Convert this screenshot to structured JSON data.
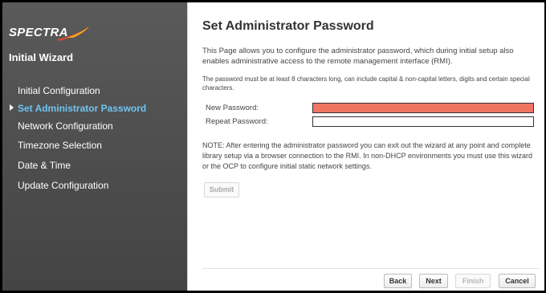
{
  "logo": {
    "text": "SPECTRA",
    "swoosh_color": "#e2482a",
    "swoosh_accent": "#f6a623"
  },
  "sidebar": {
    "title": "Initial Wizard",
    "items": [
      {
        "label": "Initial Configuration",
        "active": false
      },
      {
        "label": "Set Administrator Password",
        "active": true
      },
      {
        "label": "Network Configuration",
        "active": false
      },
      {
        "label": "Timezone Selection",
        "active": false
      },
      {
        "label": "Date & Time",
        "active": false
      },
      {
        "label": "Update Configuration",
        "active": false
      }
    ]
  },
  "main": {
    "title": "Set Administrator Password",
    "description": "This Page allows you to configure the administrator password, which during initial setup also enables administrative access to the remote management interface (RMI).",
    "requirements": "The password must be at least 8 characters long, can include capital & non-capital letters, digits and certain special characters.",
    "fields": {
      "new_password_label": "New Password:",
      "repeat_password_label": "Repeat Password:",
      "new_password_value": "",
      "repeat_password_value": ""
    },
    "note": "NOTE: After entering the administrator password you can exit out the wizard at any point and complete library setup via a browser connection to the RMI. In non-DHCP environments you must use this wizard or the OCP to configure initial static network settings.",
    "submit_label": "Submit"
  },
  "footer": {
    "back_label": "Back",
    "next_label": "Next",
    "finish_label": "Finish",
    "cancel_label": "Cancel"
  },
  "colors": {
    "sidebar_bg": "#4c4c4c",
    "active_nav": "#6fc4f0",
    "error_field": "#ef7560"
  }
}
